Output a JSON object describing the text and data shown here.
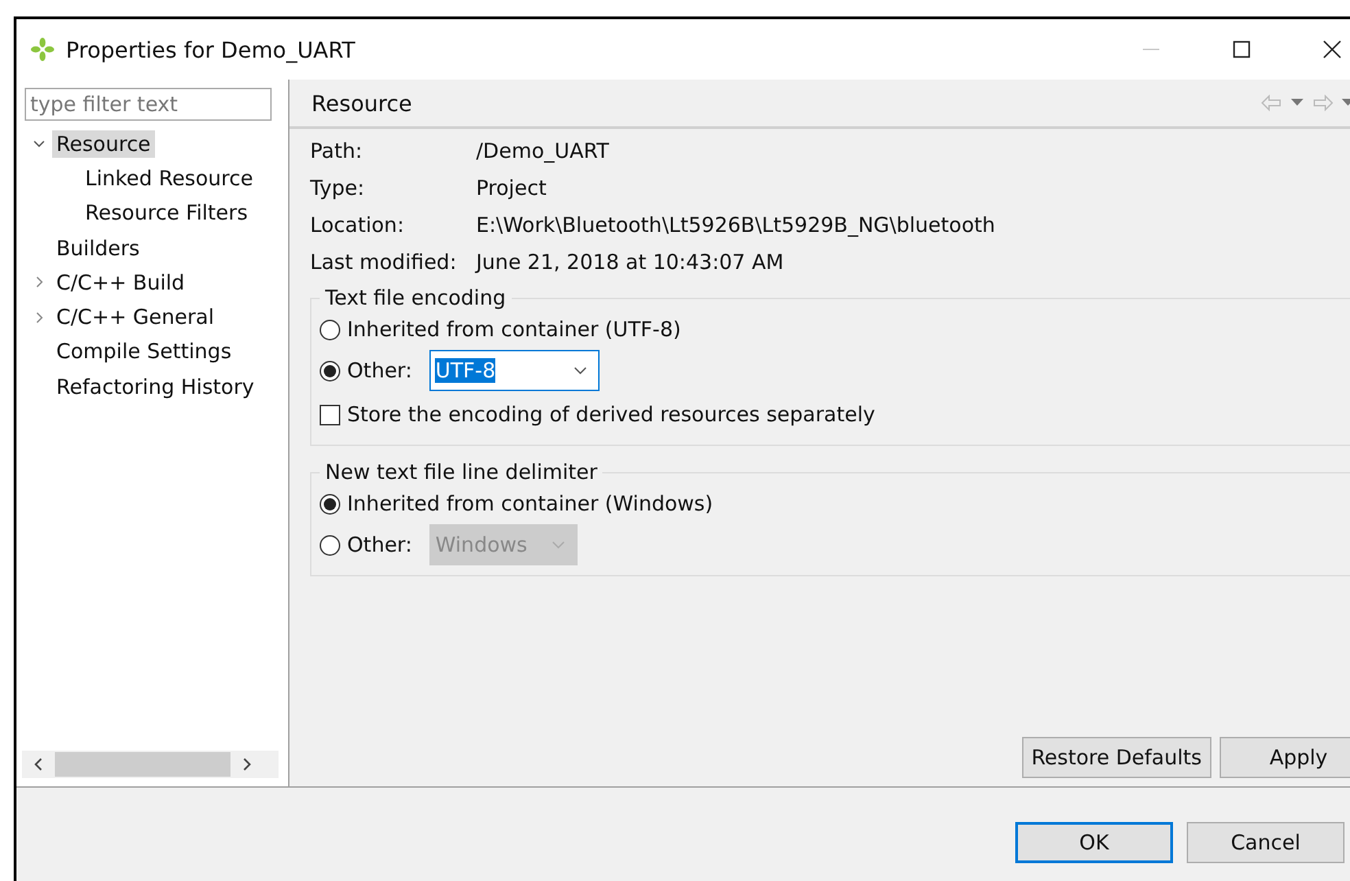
{
  "window": {
    "title": "Properties for Demo_UART"
  },
  "filter": {
    "placeholder": "type filter text"
  },
  "tree": [
    {
      "label": "Resource",
      "selected": true,
      "expanded": true,
      "children": [
        {
          "label": "Linked Resource",
          "selected": false
        },
        {
          "label": "Resource Filters",
          "selected": false
        }
      ]
    },
    {
      "label": "Builders",
      "selected": false
    },
    {
      "label": "C/C++ Build",
      "selected": false,
      "expanded": false
    },
    {
      "label": "C/C++ General",
      "selected": false,
      "expanded": false
    },
    {
      "label": "Compile Settings",
      "selected": false
    },
    {
      "label": "Refactoring History",
      "selected": false
    }
  ],
  "page": {
    "title": "Resource",
    "info": [
      {
        "label": "Path:",
        "value": "/Demo_UART"
      },
      {
        "label": "Type:",
        "value": "Project"
      },
      {
        "label": "Location:",
        "value": "E:\\Work\\Bluetooth\\Lt5926B\\Lt5929B_NG\\bluetooth"
      },
      {
        "label": "Last modified:",
        "value": "June 21, 2018 at 10:43:07 AM"
      }
    ],
    "groups": [
      {
        "title": "Text file encoding",
        "options": [
          {
            "kind": "radio",
            "label": "Inherited from container (UTF-8)",
            "checked": false
          },
          {
            "kind": "radio-select",
            "label": "Other:",
            "checked": true,
            "value": "UTF-8",
            "disabled": false
          },
          {
            "kind": "checkbox",
            "label": "Store the encoding of derived resources separately",
            "checked": false
          }
        ]
      },
      {
        "title": "New text file line delimiter",
        "options": [
          {
            "kind": "radio",
            "label": "Inherited from container (Windows)",
            "checked": true
          },
          {
            "kind": "radio-select",
            "label": "Other:",
            "checked": false,
            "value": "Windows",
            "disabled": true
          }
        ]
      }
    ],
    "buttons": [
      "Restore Defaults",
      "Apply"
    ]
  },
  "footer_buttons": [
    {
      "label": "OK",
      "default": true
    },
    {
      "label": "Cancel",
      "default": false
    }
  ]
}
